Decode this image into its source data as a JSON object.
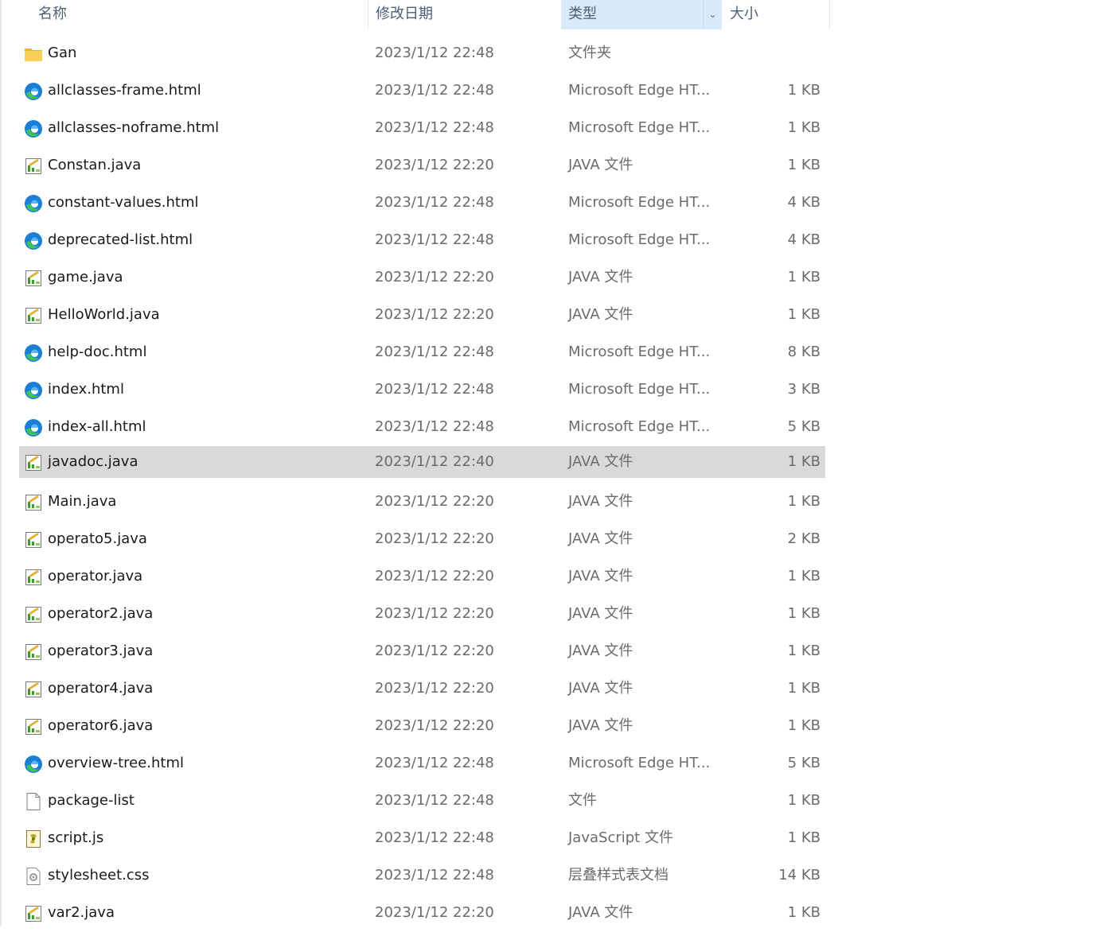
{
  "columns": {
    "name": "名称",
    "date": "修改日期",
    "type": "类型",
    "size": "大小"
  },
  "colors": {
    "header_active_bg": "#d9ebfa",
    "selected_row_bg": "#d9d9d9",
    "folder_yellow": "#f5c342",
    "edge_blue": "#1b7fd6",
    "edge_green": "#3ec25a"
  },
  "files": [
    {
      "name": "Gan",
      "date": "2023/1/12 22:48",
      "type": "文件夹",
      "size": "",
      "icon": "folder-icon"
    },
    {
      "name": "allclasses-frame.html",
      "date": "2023/1/12 22:48",
      "type": "Microsoft Edge HT...",
      "size": "1 KB",
      "icon": "edge-icon"
    },
    {
      "name": "allclasses-noframe.html",
      "date": "2023/1/12 22:48",
      "type": "Microsoft Edge HT...",
      "size": "1 KB",
      "icon": "edge-icon"
    },
    {
      "name": "Constan.java",
      "date": "2023/1/12 22:20",
      "type": "JAVA 文件",
      "size": "1 KB",
      "icon": "java-file-icon"
    },
    {
      "name": "constant-values.html",
      "date": "2023/1/12 22:48",
      "type": "Microsoft Edge HT...",
      "size": "4 KB",
      "icon": "edge-icon"
    },
    {
      "name": "deprecated-list.html",
      "date": "2023/1/12 22:48",
      "type": "Microsoft Edge HT...",
      "size": "4 KB",
      "icon": "edge-icon"
    },
    {
      "name": "game.java",
      "date": "2023/1/12 22:20",
      "type": "JAVA 文件",
      "size": "1 KB",
      "icon": "java-file-icon"
    },
    {
      "name": "HelloWorld.java",
      "date": "2023/1/12 22:20",
      "type": "JAVA 文件",
      "size": "1 KB",
      "icon": "java-file-icon"
    },
    {
      "name": "help-doc.html",
      "date": "2023/1/12 22:48",
      "type": "Microsoft Edge HT...",
      "size": "8 KB",
      "icon": "edge-icon"
    },
    {
      "name": "index.html",
      "date": "2023/1/12 22:48",
      "type": "Microsoft Edge HT...",
      "size": "3 KB",
      "icon": "edge-icon"
    },
    {
      "name": "index-all.html",
      "date": "2023/1/12 22:48",
      "type": "Microsoft Edge HT...",
      "size": "5 KB",
      "icon": "edge-icon"
    },
    {
      "name": "javadoc.java",
      "date": "2023/1/12 22:40",
      "type": "JAVA 文件",
      "size": "1 KB",
      "icon": "java-file-icon",
      "selected": true
    },
    {
      "name": "Main.java",
      "date": "2023/1/12 22:20",
      "type": "JAVA 文件",
      "size": "1 KB",
      "icon": "java-file-icon"
    },
    {
      "name": "operato5.java",
      "date": "2023/1/12 22:20",
      "type": "JAVA 文件",
      "size": "2 KB",
      "icon": "java-file-icon"
    },
    {
      "name": "operator.java",
      "date": "2023/1/12 22:20",
      "type": "JAVA 文件",
      "size": "1 KB",
      "icon": "java-file-icon"
    },
    {
      "name": "operator2.java",
      "date": "2023/1/12 22:20",
      "type": "JAVA 文件",
      "size": "1 KB",
      "icon": "java-file-icon"
    },
    {
      "name": "operator3.java",
      "date": "2023/1/12 22:20",
      "type": "JAVA 文件",
      "size": "1 KB",
      "icon": "java-file-icon"
    },
    {
      "name": "operator4.java",
      "date": "2023/1/12 22:20",
      "type": "JAVA 文件",
      "size": "1 KB",
      "icon": "java-file-icon"
    },
    {
      "name": "operator6.java",
      "date": "2023/1/12 22:20",
      "type": "JAVA 文件",
      "size": "1 KB",
      "icon": "java-file-icon"
    },
    {
      "name": "overview-tree.html",
      "date": "2023/1/12 22:48",
      "type": "Microsoft Edge HT...",
      "size": "5 KB",
      "icon": "edge-icon"
    },
    {
      "name": "package-list",
      "date": "2023/1/12 22:48",
      "type": "文件",
      "size": "1 KB",
      "icon": "blank-file-icon"
    },
    {
      "name": "script.js",
      "date": "2023/1/12 22:48",
      "type": "JavaScript 文件",
      "size": "1 KB",
      "icon": "script-file-icon"
    },
    {
      "name": "stylesheet.css",
      "date": "2023/1/12 22:48",
      "type": "层叠样式表文档",
      "size": "14 KB",
      "icon": "css-file-icon"
    },
    {
      "name": "var2.java",
      "date": "2023/1/12 22:20",
      "type": "JAVA 文件",
      "size": "1 KB",
      "icon": "java-file-icon"
    }
  ]
}
